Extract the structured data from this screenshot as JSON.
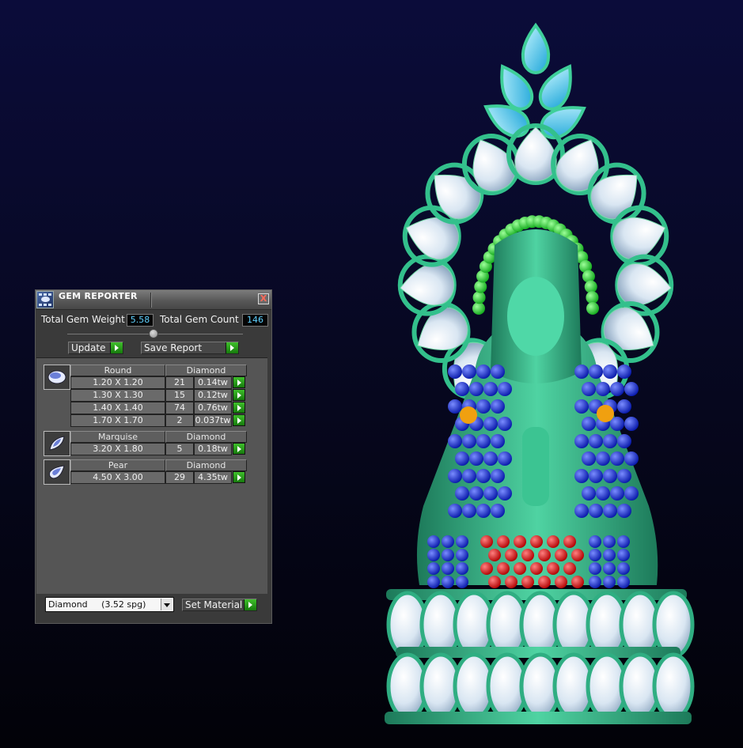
{
  "panel": {
    "title": "GEM REPORTER",
    "close_label": "X",
    "total_weight_label": "Total Gem Weight",
    "total_weight_value": "5.58",
    "total_count_label": "Total Gem Count",
    "total_count_value": "146",
    "update_label": "Update",
    "save_report_label": "Save Report",
    "material_select": "Diamond     (3.52 spg)",
    "set_material_label": "Set Material"
  },
  "gem_groups": [
    {
      "shape": "Round",
      "material": "Diamond",
      "rows": [
        {
          "size": "1.20 X 1.20",
          "count": "21",
          "weight": "0.14tw"
        },
        {
          "size": "1.30 X 1.30",
          "count": "15",
          "weight": "0.12tw"
        },
        {
          "size": "1.40 X 1.40",
          "count": "74",
          "weight": "0.76tw"
        },
        {
          "size": "1.70 X 1.70",
          "count": "2",
          "weight": "0.037tw"
        }
      ]
    },
    {
      "shape": "Marquise",
      "material": "Diamond",
      "rows": [
        {
          "size": "3.20 X 1.80",
          "count": "5",
          "weight": "0.18tw"
        }
      ]
    },
    {
      "shape": "Pear",
      "material": "Diamond",
      "rows": [
        {
          "size": "4.50 X 3.00",
          "count": "29",
          "weight": "4.35tw"
        }
      ]
    }
  ],
  "colors": {
    "background_top": "#0b0c3a",
    "metal_green": "#2fae82",
    "accent_green": "#2aa31c",
    "readout_cyan": "#5fd1ff"
  },
  "icons": [
    "gem-reporter-icon",
    "close-icon",
    "round-gem-icon",
    "marquise-gem-icon",
    "pear-gem-icon",
    "play-icon",
    "dropdown-arrow-icon"
  ]
}
